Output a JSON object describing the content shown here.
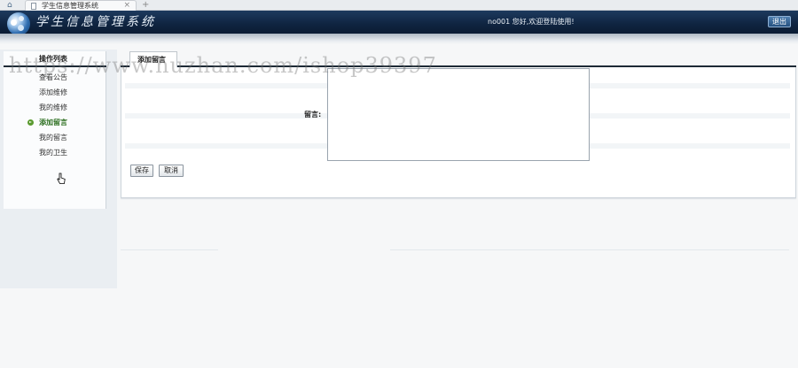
{
  "browser": {
    "tab_title": "学生信息管理系统",
    "close_glyph": "×",
    "new_tab_glyph": "+",
    "home_glyph": "⌂"
  },
  "header": {
    "app_title": "学生信息管理系统",
    "welcome_text": "no001 您好,欢迎登陆使用!",
    "logout_label": "退出"
  },
  "sidebar": {
    "title": "操作列表",
    "items": [
      {
        "label": "查看公告"
      },
      {
        "label": "添加维修"
      },
      {
        "label": "我的维修"
      },
      {
        "label": "添加留言"
      },
      {
        "label": "我的留言"
      },
      {
        "label": "我的卫生"
      }
    ],
    "active_index": 3
  },
  "main": {
    "tab_label": "添加留言",
    "field_label": "留言:",
    "message_value": "",
    "save_label": "保存",
    "cancel_label": "取消"
  },
  "watermark": "https://www.huzhan.com/ishop39397",
  "colors": {
    "header_bg": "#0f2440",
    "active_item": "#2b6e1f",
    "accent_arrow": "#5a9a2f"
  }
}
